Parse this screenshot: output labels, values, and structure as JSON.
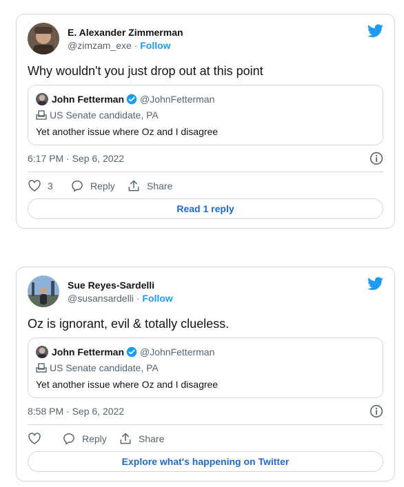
{
  "tweets": [
    {
      "author_name": "E. Alexander Zimmerman",
      "author_handle": "@zimzam_exe",
      "separator": " · ",
      "follow_label": "Follow",
      "text": "Why wouldn't you just drop out at this point",
      "quote": {
        "author_name": "John Fetterman",
        "author_handle": "@JohnFetterman",
        "label": "US Senate candidate, PA",
        "text": "Yet another issue where Oz and I disagree"
      },
      "timestamp": "6:17 PM · Sep 6, 2022",
      "likes": "3",
      "reply_label": "Reply",
      "share_label": "Share",
      "button_label": "Read 1 reply"
    },
    {
      "author_name": "Sue Reyes-Sardelli",
      "author_handle": "@susansardelli",
      "separator": " · ",
      "follow_label": "Follow",
      "text": "Oz is ignorant, evil & totally clueless.",
      "quote": {
        "author_name": "John Fetterman",
        "author_handle": "@JohnFetterman",
        "label": "US Senate candidate, PA",
        "text": "Yet another issue where Oz and I disagree"
      },
      "timestamp": "8:58 PM · Sep 6, 2022",
      "likes": "",
      "reply_label": "Reply",
      "share_label": "Share",
      "button_label": "Explore what's happening on Twitter"
    }
  ],
  "colors": {
    "accent": "#1d9bf0",
    "link": "#1d69c9",
    "muted": "#536471",
    "border": "#cfd9de"
  }
}
